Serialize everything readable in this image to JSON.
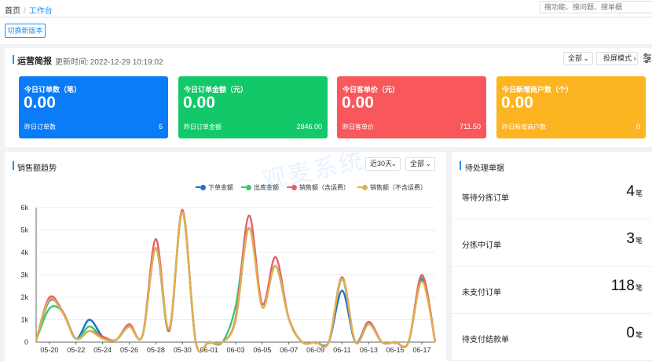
{
  "breadcrumb": {
    "home": "首页",
    "sep": "/",
    "current": "工作台"
  },
  "search": {
    "placeholder": "搜功能、搜问题、搜单据"
  },
  "switch_version": {
    "label": "切换新版本"
  },
  "ops": {
    "title": "运营简报",
    "update_label": "更新时间:",
    "update_time": "2022-12-29 10:19:02",
    "scope": "全部",
    "screen_mode": "投屏模式",
    "kpis": [
      {
        "label": "今日订单数（笔）",
        "value": "0.00",
        "sub_label": "昨日订单数",
        "sub_value": "6",
        "color": "#0a7cf7"
      },
      {
        "label": "今日订单金额（元）",
        "value": "0.00",
        "sub_label": "昨日订单金额",
        "sub_value": "2846.00",
        "color": "#11c968"
      },
      {
        "label": "今日客单价（元）",
        "value": "0.00",
        "sub_label": "昨日客单价",
        "sub_value": "711.50",
        "color": "#f8585c"
      },
      {
        "label": "今日新增商户数（个）",
        "value": "0.00",
        "sub_label": "昨日新增商户数",
        "sub_value": "0",
        "color": "#fdb421"
      }
    ]
  },
  "sales": {
    "title": "销售额趋势",
    "range": "近30天",
    "scope": "全部"
  },
  "watermark": "观麦系统",
  "chart_data": {
    "type": "line",
    "x": [
      "05-19",
      "05-20",
      "05-21",
      "05-22",
      "05-23",
      "05-24",
      "05-25",
      "05-26",
      "05-27",
      "05-28",
      "05-29",
      "05-30",
      "05-31",
      "06-01",
      "06-02",
      "06-03",
      "06-04",
      "06-05",
      "06-06",
      "06-07",
      "06-08",
      "06-09",
      "06-10",
      "06-11",
      "06-12",
      "06-13",
      "06-14",
      "06-15",
      "06-16",
      "06-17",
      "06-18"
    ],
    "x_ticks": [
      "05-20",
      "05-22",
      "05-24",
      "05-26",
      "05-28",
      "05-30",
      "06-01",
      "06-03",
      "06-05",
      "06-07",
      "06-09",
      "06-11",
      "06-13",
      "06-15",
      "06-17"
    ],
    "y_ticks": [
      "0",
      "1k",
      "2k",
      "3k",
      "4k",
      "5k",
      "6k"
    ],
    "ylim": [
      0,
      6000
    ],
    "grid": true,
    "legend_position": "top",
    "series": [
      {
        "name": "下单金额",
        "color": "#1f6fd1",
        "values": [
          80,
          1850,
          1350,
          150,
          1000,
          250,
          100,
          700,
          300,
          4200,
          500,
          5800,
          0,
          0,
          0,
          1000,
          5100,
          1700,
          3400,
          1050,
          0,
          0,
          0,
          2300,
          0,
          900,
          0,
          0,
          0,
          2800,
          0
        ]
      },
      {
        "name": "出库金额",
        "color": "#3cc770",
        "values": [
          80,
          1500,
          1350,
          150,
          700,
          200,
          100,
          700,
          300,
          4200,
          500,
          5800,
          0,
          0,
          0,
          1600,
          5100,
          1700,
          3400,
          1050,
          0,
          0,
          0,
          2800,
          0,
          800,
          0,
          0,
          0,
          2900,
          0
        ]
      },
      {
        "name": "销售额（含运费）",
        "color": "#e46168",
        "values": [
          80,
          2000,
          1350,
          150,
          500,
          250,
          100,
          800,
          300,
          4600,
          500,
          5900,
          0,
          0,
          0,
          1100,
          5650,
          1700,
          3800,
          1050,
          0,
          0,
          0,
          2900,
          0,
          900,
          0,
          0,
          0,
          3000,
          0
        ]
      },
      {
        "name": "销售额（不含运费）",
        "color": "#e0b14e",
        "values": [
          80,
          1900,
          1300,
          150,
          500,
          150,
          100,
          700,
          300,
          4200,
          600,
          5800,
          0,
          0,
          0,
          1000,
          5100,
          1550,
          3400,
          1050,
          0,
          0,
          0,
          2850,
          0,
          800,
          0,
          0,
          0,
          2700,
          0
        ]
      }
    ]
  },
  "todo": {
    "title": "待处理单据",
    "items": [
      {
        "label": "等待分拣订单",
        "value": "4",
        "unit": "笔"
      },
      {
        "label": "分拣中订单",
        "value": "3",
        "unit": "笔"
      },
      {
        "label": "未支付订单",
        "value": "118",
        "unit": "笔"
      },
      {
        "label": "待支付结款单",
        "value": "0",
        "unit": "笔"
      }
    ]
  }
}
